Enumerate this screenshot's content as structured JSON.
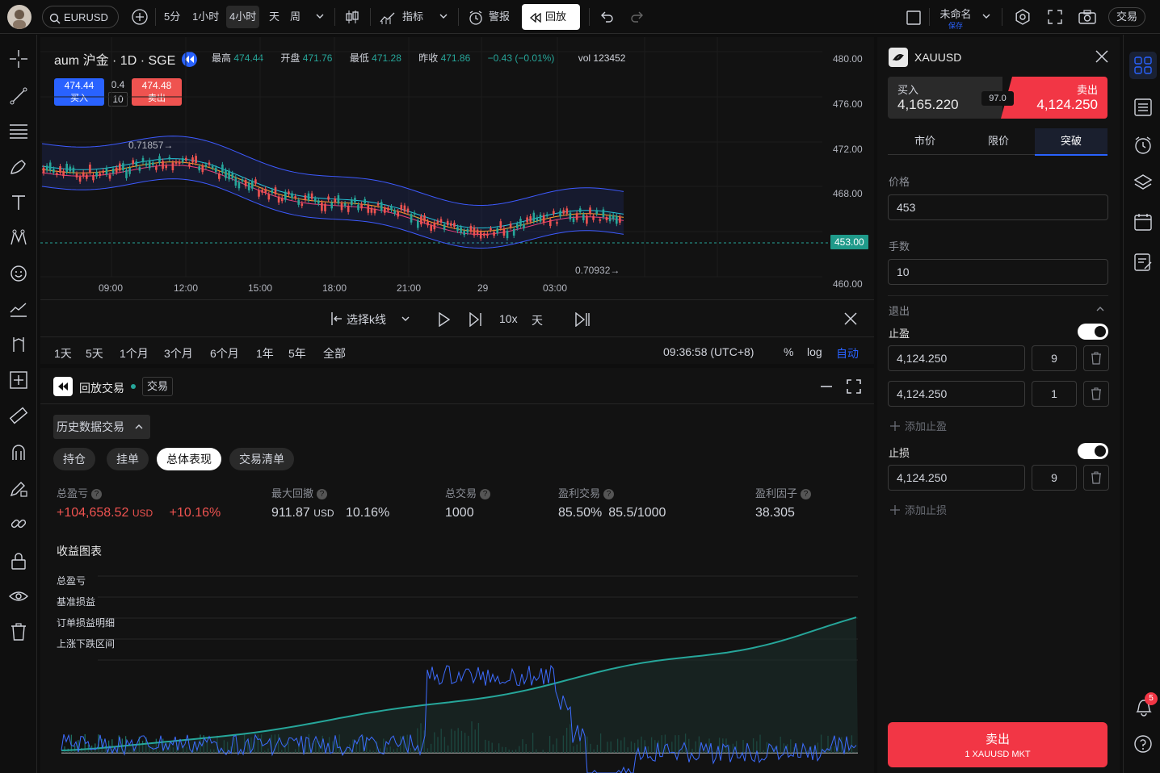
{
  "topbar": {
    "symbol": "EURUSD",
    "intervals": [
      "5分",
      "1小时",
      "4小时",
      "天",
      "周"
    ],
    "active_interval": "4小时",
    "indicators_label": "指标",
    "alert_label": "警报",
    "replay_label": "回放",
    "layout_name": "未命名",
    "layout_saved": "保存",
    "trade_label": "交易"
  },
  "legend": {
    "symbol": "aum 沪金 · 1D · SGE",
    "high_label": "最高",
    "high": "474.44",
    "open_label": "开盘",
    "open": "471.76",
    "low_label": "最低",
    "low": "471.28",
    "prev_label": "昨收",
    "prev": "471.86",
    "change": "−0.43 (−0.01%)",
    "vol_label": "vol",
    "vol": "123452",
    "buy_price": "474.44",
    "buy_label": "买入",
    "spread_top": "0.4",
    "spread_bottom": "10",
    "sell_price": "474.48",
    "sell_label": "卖出"
  },
  "chart": {
    "y_ticks": [
      "480.00",
      "476.00",
      "472.00",
      "468.00",
      "464.00",
      "460.00"
    ],
    "x_ticks": [
      "09:00",
      "12:00",
      "15:00",
      "18:00",
      "21:00",
      "29",
      "03:00"
    ],
    "current_price": "453.00",
    "annot_high": "0.71857",
    "annot_low": "0.70932",
    "colors": {
      "up": "#26a69a",
      "down": "#ef5350",
      "band": "#3d5afe"
    }
  },
  "replay_bar": {
    "select_kline": "选择k线",
    "speed": "10x",
    "unit": "天"
  },
  "range_bar": {
    "ranges": [
      "1天",
      "5天",
      "1个月",
      "3个月",
      "6个月",
      "1年",
      "5年",
      "全部"
    ],
    "time": "09:36:58 (UTC+8)",
    "percent": "%",
    "log": "log",
    "auto": "自动"
  },
  "replay_panel": {
    "title": "回放交易",
    "trade_tab": "交易",
    "history_dropdown": "历史数据交易",
    "tabs": [
      "持仓",
      "挂单",
      "总体表现",
      "交易清单"
    ],
    "active_tab": "总体表现",
    "stats": {
      "total_pnl_label": "总盈亏",
      "total_pnl": "+104,658.52",
      "total_pnl_unit": "USD",
      "total_pnl_pct": "+10.16%",
      "max_dd_label": "最大回撤",
      "max_dd": "911.87",
      "max_dd_unit": "USD",
      "max_dd_pct": "10.16%",
      "total_trades_label": "总交易",
      "total_trades": "1000",
      "win_label": "盈利交易",
      "win_pct": "85.50%",
      "win_ratio": "85.5/1000",
      "pf_label": "盈利因子",
      "pf": "38.305"
    },
    "equity_title": "收益图表",
    "equity_legend": [
      "总盈亏",
      "基准损益",
      "订单损益明细",
      "上涨下跌区间"
    ]
  },
  "order_panel": {
    "symbol": "XAUUSD",
    "buy_label": "买入",
    "buy_price": "4,165.220",
    "spread": "97.0",
    "sell_label": "卖出",
    "sell_price": "4,124.250",
    "order_tabs": [
      "市价",
      "限价",
      "突破"
    ],
    "active_order_tab": "突破",
    "price_label": "价格",
    "price": "453",
    "qty_label": "手数",
    "qty": "10",
    "exit_label": "退出",
    "tp_label": "止盈",
    "tp_rows": [
      {
        "price": "4,124.250",
        "qty": "9"
      },
      {
        "price": "4,124.250",
        "qty": "1"
      }
    ],
    "add_tp": "添加止盈",
    "sl_label": "止损",
    "sl_rows": [
      {
        "price": "4,124.250",
        "qty": "9"
      }
    ],
    "add_sl": "添加止损",
    "submit_label": "卖出",
    "submit_sub": "1 XAUUSD MKT"
  },
  "rightbar": {
    "notifications": "5"
  }
}
